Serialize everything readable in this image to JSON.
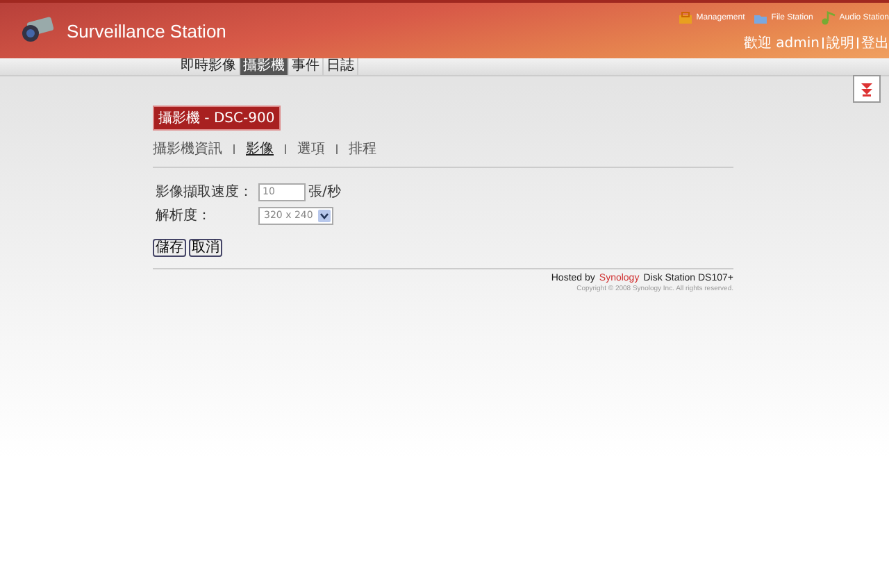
{
  "header": {
    "title": "Surveillance Station",
    "apps": [
      {
        "label": "Management",
        "kind": "management"
      },
      {
        "label": "File Station",
        "kind": "file"
      },
      {
        "label": "Audio Station",
        "kind": "audio"
      }
    ],
    "user_links": [
      "歡迎 admin",
      "說明",
      "登出"
    ]
  },
  "tabs": [
    {
      "label": "即時影像",
      "selected": false
    },
    {
      "label": "攝影機",
      "selected": true
    },
    {
      "label": "事件",
      "selected": false
    },
    {
      "label": "日誌",
      "selected": false
    }
  ],
  "camera_title": "攝影機 - DSC-900",
  "subtabs": [
    {
      "label": "攝影機資訊",
      "selected": false
    },
    {
      "label": "影像",
      "selected": true
    },
    {
      "label": "選項",
      "selected": false
    },
    {
      "label": "排程",
      "selected": false
    }
  ],
  "form": {
    "fields": [
      {
        "label": "影像擷取速度：",
        "kind": "text",
        "value": "10",
        "unit": "張/秒"
      },
      {
        "label": "解析度：",
        "kind": "select",
        "value": "320 x 240"
      }
    ]
  },
  "buttons": [
    "儲存",
    "取消"
  ],
  "footer": {
    "hosted_prefix": "Hosted by",
    "brand": "Synology",
    "hosted_suffix": "Disk Station DS107+",
    "copyright": "Copyright © 2008 Synology Inc. All rights reserved."
  }
}
